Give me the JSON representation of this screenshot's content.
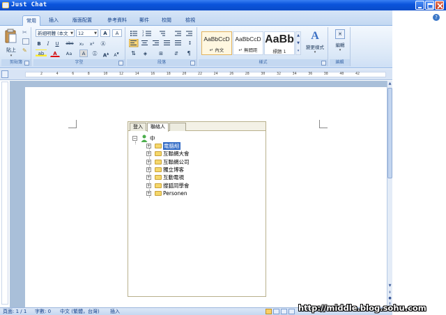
{
  "window": {
    "title": "Just Chat",
    "minimize_icon": "minimize-icon",
    "maximize_icon": "maximize-icon",
    "close_icon": "close-icon"
  },
  "ribbon": {
    "tabs": [
      {
        "label": "常用",
        "active": true
      },
      {
        "label": "插入",
        "active": false
      },
      {
        "label": "版面配置",
        "active": false
      },
      {
        "label": "參考資料",
        "active": false
      },
      {
        "label": "郵件",
        "active": false
      },
      {
        "label": "校閱",
        "active": false
      },
      {
        "label": "檢視",
        "active": false
      }
    ],
    "help_icon": "help-icon",
    "clipboard": {
      "label": "剪貼簿",
      "paste_label": "貼上"
    },
    "font": {
      "label": "字型",
      "font_name": "新細明體 (本文",
      "font_size": "12",
      "bold": "B",
      "italic": "I",
      "underline": "U",
      "strike": "abe",
      "sub": "x₂",
      "sup": "x²",
      "font_color": "A",
      "change_case": "Aa",
      "grow": "A",
      "shrink": "A"
    },
    "paragraph": {
      "label": "段落"
    },
    "styles": {
      "label": "樣式",
      "items": [
        {
          "sample": "AaBbCcD",
          "name": "↵ 內文",
          "selected": true
        },
        {
          "sample": "AaBbCcD",
          "name": "↵ 無間距",
          "selected": false
        },
        {
          "sample": "AaBb",
          "name": "標題 1",
          "selected": false
        }
      ],
      "change_styles_label": "變更樣式"
    },
    "editing": {
      "label": "編輯",
      "label_top": "編輯"
    }
  },
  "ruler": {
    "numbers": [
      "2",
      "4",
      "6",
      "8",
      "10",
      "12",
      "14",
      "16",
      "18",
      "20",
      "22",
      "24",
      "26",
      "28",
      "30",
      "32",
      "34",
      "36",
      "38",
      "40",
      "42"
    ]
  },
  "chat": {
    "tabs": [
      {
        "label": "登入",
        "active": false
      },
      {
        "label": "聯絡人",
        "active": true
      },
      {
        "label": "",
        "active": false
      }
    ],
    "root": {
      "label": "中"
    },
    "groups": [
      {
        "label": "電腦組",
        "selected": true
      },
      {
        "label": "互聯網大會",
        "selected": false
      },
      {
        "label": "互聯網公司",
        "selected": false
      },
      {
        "label": "獨立博客",
        "selected": false
      },
      {
        "label": "互動電視",
        "selected": false
      },
      {
        "label": "搜狐同學會",
        "selected": false
      },
      {
        "label": "Personen",
        "selected": false
      }
    ]
  },
  "status": {
    "page": "頁面: 1 / 1",
    "words": "字數: 0",
    "language": "中文 (繁體，台灣)",
    "mode": "插入"
  },
  "watermark": "http://middle.blog.sohu.com"
}
